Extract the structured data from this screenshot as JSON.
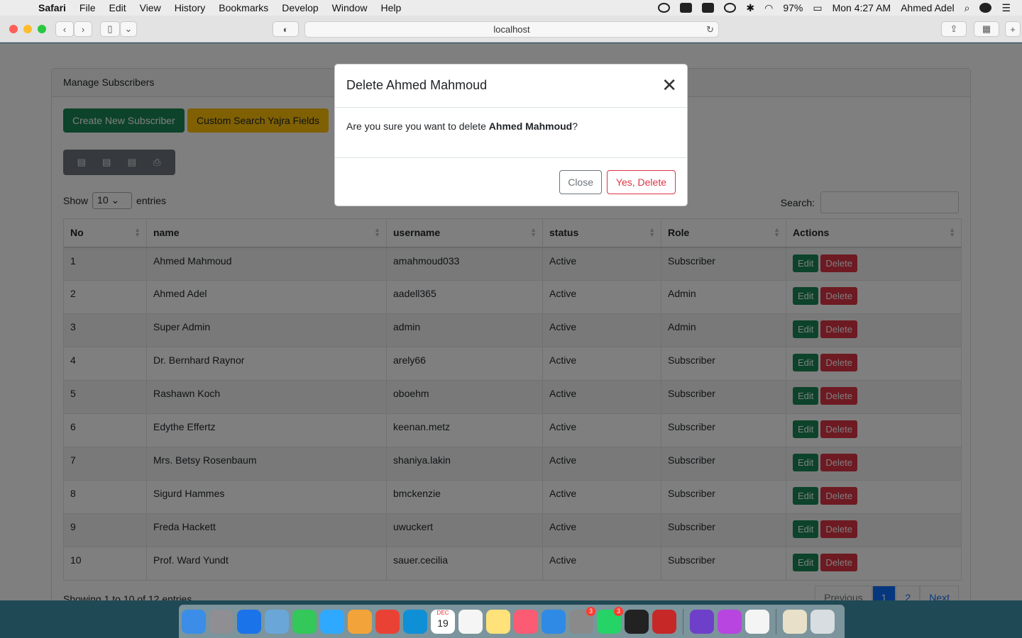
{
  "menubar": {
    "app": "Safari",
    "items": [
      "File",
      "Edit",
      "View",
      "History",
      "Bookmarks",
      "Develop",
      "Window",
      "Help"
    ],
    "battery": "97%",
    "clock": "Mon 4:27 AM",
    "user": "Ahmed Adel"
  },
  "browser": {
    "url": "localhost"
  },
  "card": {
    "title": "Manage Subscribers",
    "create_button": "Create New Subscriber",
    "custom_search_button": "Custom Search Yajra Fields",
    "export_icons": [
      "excel-file-icon",
      "csv-file-icon",
      "pdf-file-icon",
      "printer-icon"
    ],
    "show_label": "Show",
    "entries_value": "10",
    "entries_label": "entries",
    "search_label": "Search:"
  },
  "table": {
    "headers": [
      "No",
      "name",
      "username",
      "status",
      "Role",
      "Actions"
    ],
    "edit_label": "Edit",
    "delete_label": "Delete",
    "rows": [
      {
        "no": "1",
        "name": "Ahmed Mahmoud",
        "username": "amahmoud033",
        "status": "Active",
        "role": "Subscriber"
      },
      {
        "no": "2",
        "name": "Ahmed Adel",
        "username": "aadell365",
        "status": "Active",
        "role": "Admin"
      },
      {
        "no": "3",
        "name": "Super Admin",
        "username": "admin",
        "status": "Active",
        "role": "Admin"
      },
      {
        "no": "4",
        "name": "Dr. Bernhard Raynor",
        "username": "arely66",
        "status": "Active",
        "role": "Subscriber"
      },
      {
        "no": "5",
        "name": "Rashawn Koch",
        "username": "oboehm",
        "status": "Active",
        "role": "Subscriber"
      },
      {
        "no": "6",
        "name": "Edythe Effertz",
        "username": "keenan.metz",
        "status": "Active",
        "role": "Subscriber"
      },
      {
        "no": "7",
        "name": "Mrs. Betsy Rosenbaum",
        "username": "shaniya.lakin",
        "status": "Active",
        "role": "Subscriber"
      },
      {
        "no": "8",
        "name": "Sigurd Hammes",
        "username": "bmckenzie",
        "status": "Active",
        "role": "Subscriber"
      },
      {
        "no": "9",
        "name": "Freda Hackett",
        "username": "uwuckert",
        "status": "Active",
        "role": "Subscriber"
      },
      {
        "no": "10",
        "name": "Prof. Ward Yundt",
        "username": "sauer.cecilia",
        "status": "Active",
        "role": "Subscriber"
      }
    ],
    "footer_info": "Showing 1 to 10 of 12 entries",
    "pager": {
      "previous": "Previous",
      "page1": "1",
      "page2": "2",
      "next": "Next"
    }
  },
  "modal": {
    "title": "Delete Ahmed Mahmoud",
    "body_prefix": "Are you sure you want to delete ",
    "body_name": "Ahmed Mahmoud",
    "body_suffix": "?",
    "close_button": "Close",
    "confirm_button": "Yes, Delete"
  },
  "dock": {
    "apps": [
      {
        "name": "finder-icon",
        "color": "#3b8de8"
      },
      {
        "name": "launchpad-icon",
        "color": "#8e8e93"
      },
      {
        "name": "safari-icon",
        "color": "#1a73e8"
      },
      {
        "name": "preview-icon",
        "color": "#6aa7d8"
      },
      {
        "name": "facetime-icon",
        "color": "#34c759"
      },
      {
        "name": "messages-icon",
        "color": "#2fa8ff"
      },
      {
        "name": "photos-icon",
        "color": "#f2a33a"
      },
      {
        "name": "chrome-icon",
        "color": "#e94235"
      },
      {
        "name": "edge-icon",
        "color": "#0f8fd6"
      },
      {
        "name": "calendar-icon",
        "color": "#ffffff"
      },
      {
        "name": "reminders-icon",
        "color": "#f5f5f5"
      },
      {
        "name": "notes-icon",
        "color": "#ffe27a"
      },
      {
        "name": "music-icon",
        "color": "#fb5c74"
      },
      {
        "name": "keynote-icon",
        "color": "#2f8ae6"
      },
      {
        "name": "system-preferences-icon",
        "color": "#8a8a8a"
      },
      {
        "name": "whatsapp-icon",
        "color": "#25d366"
      },
      {
        "name": "terminal-icon",
        "color": "#222222"
      },
      {
        "name": "database-icon",
        "color": "#c62828"
      },
      {
        "name": "github-desktop-icon",
        "color": "#6e40c9"
      },
      {
        "name": "phpstorm-icon",
        "color": "#b845e0"
      },
      {
        "name": "textedit-icon",
        "color": "#f4f4f4"
      },
      {
        "name": "sql-file-icon",
        "color": "#e8e0c8"
      },
      {
        "name": "trash-icon",
        "color": "#d7dde0"
      }
    ],
    "calendar_month": "DEC",
    "calendar_day": "19",
    "system_prefs_badge": "3",
    "whatsapp_badge": "3"
  }
}
